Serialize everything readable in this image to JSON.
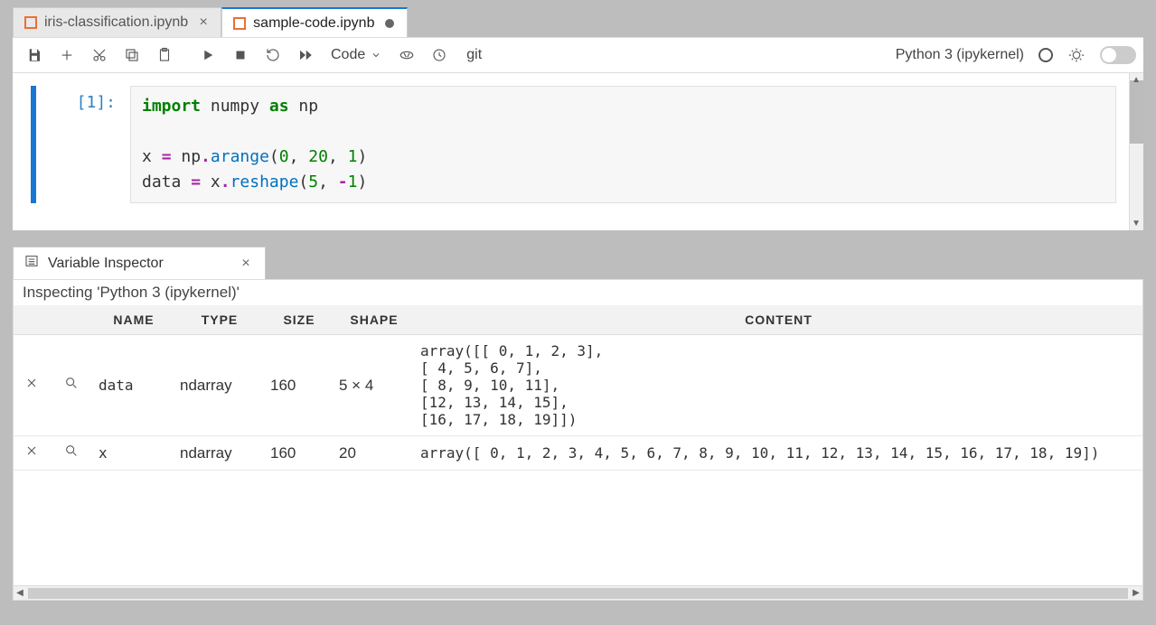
{
  "tabs": [
    {
      "label": "iris-classification.ipynb",
      "active": false,
      "dirty": false
    },
    {
      "label": "sample-code.ipynb",
      "active": true,
      "dirty": true
    }
  ],
  "toolbar": {
    "cell_type": "Code",
    "git_label": "git",
    "kernel_name": "Python 3 (ipykernel)"
  },
  "cell": {
    "prompt": "[1]:",
    "code_tokens": [
      {
        "t": "import",
        "c": "kw"
      },
      {
        "t": " numpy ",
        "c": ""
      },
      {
        "t": "as",
        "c": "kw"
      },
      {
        "t": " np\n\n",
        "c": ""
      },
      {
        "t": "x ",
        "c": ""
      },
      {
        "t": "=",
        "c": "op"
      },
      {
        "t": " np",
        "c": ""
      },
      {
        "t": ".",
        "c": "op"
      },
      {
        "t": "arange",
        "c": "fn"
      },
      {
        "t": "(",
        "c": "paren"
      },
      {
        "t": "0",
        "c": "num"
      },
      {
        "t": ", ",
        "c": ""
      },
      {
        "t": "20",
        "c": "num"
      },
      {
        "t": ", ",
        "c": ""
      },
      {
        "t": "1",
        "c": "num"
      },
      {
        "t": ")\n",
        "c": "paren"
      },
      {
        "t": "data ",
        "c": ""
      },
      {
        "t": "=",
        "c": "op"
      },
      {
        "t": " x",
        "c": ""
      },
      {
        "t": ".",
        "c": "op"
      },
      {
        "t": "reshape",
        "c": "fn"
      },
      {
        "t": "(",
        "c": "paren"
      },
      {
        "t": "5",
        "c": "num"
      },
      {
        "t": ", ",
        "c": ""
      },
      {
        "t": "-",
        "c": "op"
      },
      {
        "t": "1",
        "c": "num"
      },
      {
        "t": ")",
        "c": "paren"
      }
    ]
  },
  "inspector": {
    "tab_label": "Variable Inspector",
    "caption": "Inspecting 'Python 3 (ipykernel)'",
    "columns": {
      "name": "NAME",
      "type": "TYPE",
      "size": "SIZE",
      "shape": "SHAPE",
      "content": "CONTENT"
    },
    "rows": [
      {
        "name": "data",
        "type": "ndarray",
        "size": "160",
        "shape": "5 × 4",
        "content": "array([[ 0, 1, 2, 3],\n[ 4, 5, 6, 7],\n[ 8, 9, 10, 11],\n[12, 13, 14, 15],\n[16, 17, 18, 19]])"
      },
      {
        "name": "x",
        "type": "ndarray",
        "size": "160",
        "shape": "20",
        "content": "array([ 0, 1, 2, 3, 4, 5, 6, 7, 8, 9, 10, 11, 12, 13, 14, 15, 16, 17, 18, 19])"
      }
    ]
  }
}
